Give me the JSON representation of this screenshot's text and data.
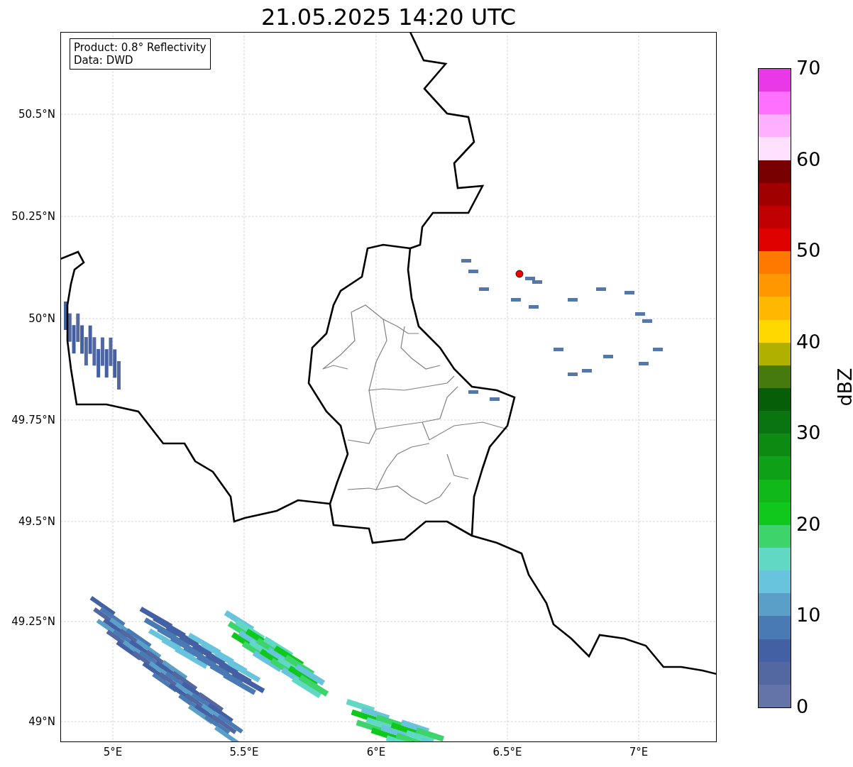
{
  "title": "21.05.2025 14:20 UTC",
  "info_box": {
    "lines": [
      "Product: 0.8° Reflectivity",
      "Data: DWD"
    ]
  },
  "map": {
    "y_ticks": [
      "50.5°N",
      "50.25°N",
      "50°N",
      "49.75°N",
      "49.5°N",
      "49.25°N",
      "49°N"
    ],
    "x_ticks": [
      "5°E",
      "5.5°E",
      "6°E",
      "6.5°E",
      "7°E"
    ]
  },
  "colorbar": {
    "label": "dBZ",
    "ticks": [
      "70",
      "60",
      "50",
      "40",
      "30",
      "20",
      "10",
      "0"
    ],
    "segments": [
      {
        "color": "#e838e8"
      },
      {
        "color": "#ff70ff"
      },
      {
        "color": "#ffb0ff"
      },
      {
        "color": "#ffe0ff"
      },
      {
        "color": "#780000"
      },
      {
        "color": "#a00000"
      },
      {
        "color": "#c00000"
      },
      {
        "color": "#e00000"
      },
      {
        "color": "#ff7800"
      },
      {
        "color": "#ff9800"
      },
      {
        "color": "#ffb800"
      },
      {
        "color": "#ffd800"
      },
      {
        "color": "#b0b000"
      },
      {
        "color": "#467a0e"
      },
      {
        "color": "#065e08"
      },
      {
        "color": "#0a7410"
      },
      {
        "color": "#0c8a12"
      },
      {
        "color": "#0ea016"
      },
      {
        "color": "#10b81a"
      },
      {
        "color": "#10c81c"
      },
      {
        "color": "#3dd46c"
      },
      {
        "color": "#60d8c4"
      },
      {
        "color": "#68c3dc"
      },
      {
        "color": "#5a9fc8"
      },
      {
        "color": "#4a7ab4"
      },
      {
        "color": "#4460a4"
      },
      {
        "color": "#5367a0"
      },
      {
        "color": "#6474a8"
      }
    ]
  }
}
